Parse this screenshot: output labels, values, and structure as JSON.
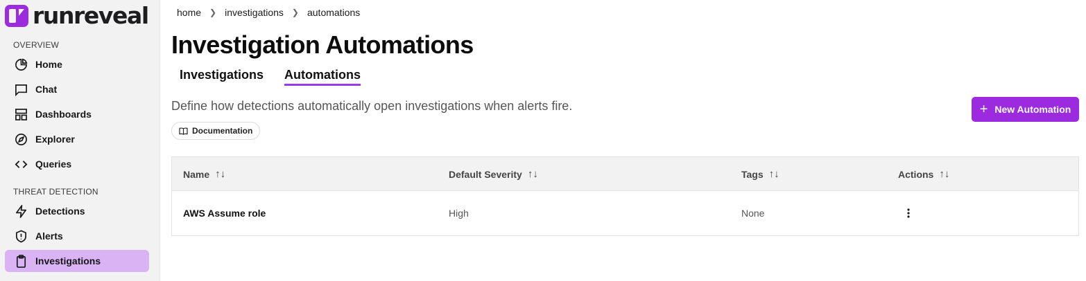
{
  "brand": {
    "logo_text": "runreveal",
    "accent_color": "#9c2bdf",
    "active_nav_color": "#d9b3f3"
  },
  "sidebar": {
    "overview_label": "OVERVIEW",
    "threat_label": "THREAT DETECTION",
    "items": [
      {
        "label": "Home",
        "icon": "pie-chart-icon"
      },
      {
        "label": "Chat",
        "icon": "chat-bubble-icon"
      },
      {
        "label": "Dashboards",
        "icon": "dashboard-layout-icon"
      },
      {
        "label": "Explorer",
        "icon": "compass-icon"
      },
      {
        "label": "Queries",
        "icon": "code-brackets-icon"
      },
      {
        "label": "Detections",
        "icon": "lightning-icon"
      },
      {
        "label": "Alerts",
        "icon": "shield-alert-icon"
      },
      {
        "label": "Investigations",
        "icon": "clipboard-icon",
        "active": true
      }
    ]
  },
  "breadcrumb": [
    "home",
    "investigations",
    "automations"
  ],
  "page": {
    "title": "Investigation Automations",
    "tabs": [
      {
        "label": "Investigations",
        "active": false
      },
      {
        "label": "Automations",
        "active": true
      }
    ],
    "description": "Define how detections automatically open investigations when alerts fire.",
    "documentation_label": "Documentation",
    "new_button_label": "New Automation"
  },
  "table": {
    "columns": [
      "Name",
      "Default Severity",
      "Tags",
      "Actions"
    ],
    "sort_icon": "↑↓",
    "rows": [
      {
        "name": "AWS Assume role",
        "severity": "High",
        "tags": "None",
        "actions_icon": "more-vertical-icon"
      }
    ]
  }
}
